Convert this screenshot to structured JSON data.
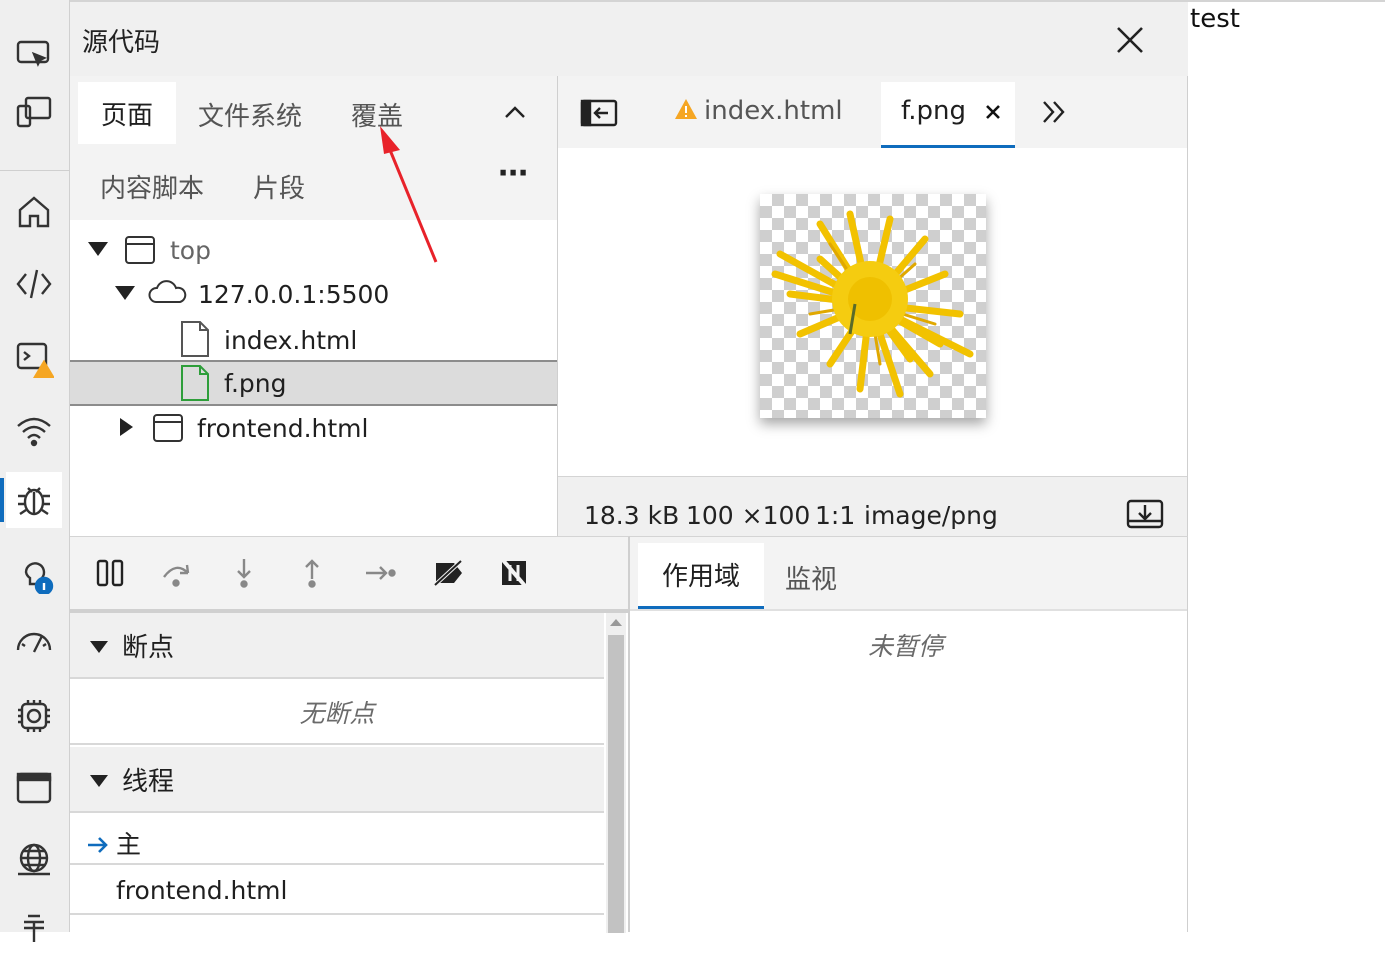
{
  "panel": {
    "title": "源代码"
  },
  "navigator": {
    "tabs": [
      "页面",
      "文件系统",
      "覆盖",
      "内容脚本",
      "片段"
    ],
    "more": "⋯",
    "tree": {
      "top": "top",
      "host": "127.0.0.1:5500",
      "file1": "index.html",
      "file2": "f.png",
      "frame": "frontend.html"
    }
  },
  "editor": {
    "tabs": {
      "tab1": "index.html",
      "tab2": "f.png"
    },
    "status": {
      "size": "18.3 kB",
      "dims": "100 ×100",
      "ratio": "1:1",
      "mime": "image/png"
    }
  },
  "debugger": {
    "breakpoints": {
      "title": "断点",
      "empty": "无断点"
    },
    "threads": {
      "title": "线程",
      "main": "主",
      "frontend": "frontend.html"
    }
  },
  "scope": {
    "tabs": [
      "作用域",
      "监视"
    ],
    "empty": "未暂停"
  },
  "page": {
    "text": "test"
  },
  "colors": {
    "accent": "#0f6cbd",
    "annotation": "#e8222a",
    "warning": "#f5a623",
    "flower": "#f2c200"
  }
}
